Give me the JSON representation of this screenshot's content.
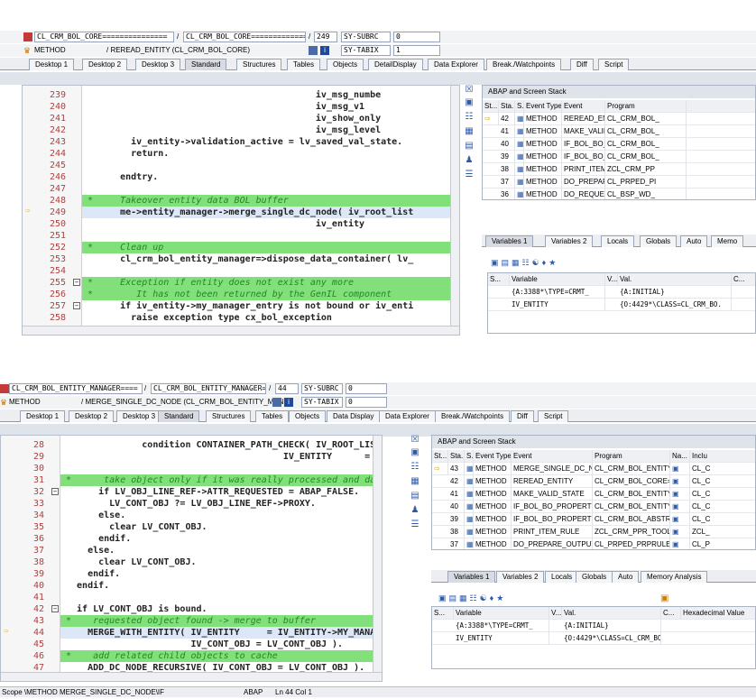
{
  "top": {
    "header1": {
      "class_a": "CL_CRM_BOL_CORE===============",
      "sep": "/",
      "class_b": "CL_CRM_BOL_CORE===============",
      "slash": "/",
      "line": "249",
      "sysvar": "SY-SUBRC",
      "sysval": "0"
    },
    "header2": {
      "type": "METHOD",
      "method": "/ REREAD_ENTITY (CL_CRM_BOL_CORE)",
      "sysvar": "SY-TABIX",
      "sysval": "1"
    },
    "tabs": [
      "Desktop 1",
      "Desktop 2",
      "Desktop 3",
      "Standard",
      "Structures",
      "Tables",
      "Objects",
      "DetailDisplay",
      "Data Explorer",
      "Break./Watchpoints",
      "Diff",
      "Script"
    ],
    "active_tab": 3,
    "code": [
      {
        "n": "239",
        "t": "                                          iv_msg_numbe",
        "style": "code"
      },
      {
        "n": "240",
        "t": "                                          iv_msg_v1",
        "style": "code"
      },
      {
        "n": "241",
        "t": "                                          iv_show_only",
        "style": "code"
      },
      {
        "n": "242",
        "t": "                                          iv_msg_level",
        "style": "code"
      },
      {
        "n": "243",
        "t": "        iv_entity->validation_active = lv_saved_val_state.",
        "style": "code"
      },
      {
        "n": "244",
        "t": "        return.",
        "style": "code"
      },
      {
        "n": "245",
        "t": "",
        "style": "code"
      },
      {
        "n": "246",
        "t": "      endtry.",
        "style": "code"
      },
      {
        "n": "247",
        "t": "",
        "style": "code"
      },
      {
        "n": "248",
        "t": "*     Takeover entity data BOL buffer",
        "style": "comment"
      },
      {
        "n": "249",
        "t": "      me->entity_manager->merge_single_dc_node( iv_root_list",
        "style": "code"
      },
      {
        "n": "250",
        "t": "                                          iv_entity",
        "style": "code"
      },
      {
        "n": "251",
        "t": "",
        "style": "code"
      },
      {
        "n": "252",
        "t": "*     Clean up",
        "style": "comment"
      },
      {
        "n": "253",
        "t": "      cl_crm_bol_entity_manager=>dispose_data_container( lv_",
        "style": "code"
      },
      {
        "n": "254",
        "t": "",
        "style": "code"
      },
      {
        "n": "255",
        "t": "*     Exception if entity does not exist any more",
        "style": "comment"
      },
      {
        "n": "256",
        "t": "*        It has not been returned by the GenIL component",
        "style": "comment"
      },
      {
        "n": "257",
        "t": "      if iv_entity->my_manager_entry is not bound or iv_enti",
        "style": "code"
      },
      {
        "n": "258",
        "t": "        raise exception type cx_bol_exception",
        "style": "code"
      }
    ],
    "stack": {
      "title": "ABAP and Screen Stack",
      "headers": [
        "St...",
        "Sta...",
        "S...",
        "Event Type",
        "Event",
        "Program"
      ],
      "rows": [
        {
          "sta": "42",
          "type": "METHOD",
          "event": "REREAD_ENTITY",
          "prog": "CL_CRM_BOL_"
        },
        {
          "sta": "41",
          "type": "METHOD",
          "event": "MAKE_VALID_STATE",
          "prog": "CL_CRM_BOL_"
        },
        {
          "sta": "40",
          "type": "METHOD",
          "event": "IF_BOL_BO_PROPERTY_...",
          "prog": "CL_CRM_BOL_"
        },
        {
          "sta": "39",
          "type": "METHOD",
          "event": "IF_BOL_BO_PROPERTY_...",
          "prog": "CL_CRM_BOL_"
        },
        {
          "sta": "38",
          "type": "METHOD",
          "event": "PRINT_ITEM_RULE",
          "prog": "ZCL_CRM_PP"
        },
        {
          "sta": "37",
          "type": "METHOD",
          "event": "DO_PREPARE_OUTPUT",
          "prog": "CL_PRPED_PI"
        },
        {
          "sta": "36",
          "type": "METHOD",
          "event": "DO_REQUEST",
          "prog": "CL_BSP_WD_"
        }
      ]
    },
    "var_tabs": [
      "Variables 1",
      "Variables 2",
      "Locals",
      "Globals",
      "Auto",
      "Memo"
    ],
    "vars": {
      "headers": [
        "S...",
        "Variable",
        "V...",
        "Val.",
        "C..."
      ],
      "rows": [
        {
          "name": "{A:3388*\\TYPE=CRMT_",
          "val": "{A:INITIAL}"
        },
        {
          "name": "IV_ENTITY",
          "val": "{O:4429*\\CLASS=CL_CRM_BO."
        }
      ]
    }
  },
  "bottom": {
    "header1": {
      "class_a": "CL_CRM_BOL_ENTITY_MANAGER====",
      "sep": "/",
      "class_b": "CL_CRM_BOL_ENTITY_MANAGER====",
      "slash": "/",
      "line": "44",
      "sysvar": "SY-SUBRC",
      "sysval": "0"
    },
    "header2": {
      "type": "METHOD",
      "method": "/ MERGE_SINGLE_DC_NODE (CL_CRM_BOL_ENTITY_MAN",
      "sysvar": "SY-TABIX",
      "sysval": "0"
    },
    "tabs": [
      "Desktop 1",
      "Desktop 2",
      "Desktop 3",
      "Standard",
      "Structures",
      "Tables",
      "Objects",
      "Data Display",
      "Data Explorer",
      "Break./Watchpoints",
      "Diff",
      "Script"
    ],
    "active_tab": 3,
    "code": [
      {
        "n": "28",
        "t": "              condition CONTAINER_PATH_CHECK( IV_ROOT_LIST =",
        "style": "code"
      },
      {
        "n": "29",
        "t": "                                        IV_ENTITY      =",
        "style": "code"
      },
      {
        "n": "30",
        "t": "",
        "style": "code"
      },
      {
        "n": "31",
        "t": "*      take object only if it was really processed and data s",
        "style": "comment"
      },
      {
        "n": "32",
        "t": "      if LV_OBJ_LINE_REF->ATTR_REQUESTED = ABAP_FALSE.",
        "style": "code"
      },
      {
        "n": "33",
        "t": "        LV_CONT_OBJ ?= LV_OBJ_LINE_REF->PROXY.",
        "style": "code"
      },
      {
        "n": "34",
        "t": "      else.",
        "style": "code"
      },
      {
        "n": "35",
        "t": "        clear LV_CONT_OBJ.",
        "style": "code"
      },
      {
        "n": "36",
        "t": "      endif.",
        "style": "code"
      },
      {
        "n": "37",
        "t": "    else.",
        "style": "code"
      },
      {
        "n": "38",
        "t": "      clear LV_CONT_OBJ.",
        "style": "code"
      },
      {
        "n": "39",
        "t": "    endif.",
        "style": "code"
      },
      {
        "n": "40",
        "t": "  endif.",
        "style": "code"
      },
      {
        "n": "41",
        "t": "",
        "style": "code"
      },
      {
        "n": "42",
        "t": "  if LV_CONT_OBJ is bound.",
        "style": "code"
      },
      {
        "n": "43",
        "t": "*    requested object found -> merge to buffer",
        "style": "comment"
      },
      {
        "n": "44",
        "t": "    MERGE_WITH_ENTITY( IV_ENTITY     = IV_ENTITY->MY_MANAGER_E",
        "style": "code"
      },
      {
        "n": "45",
        "t": "                       IV_CONT_OBJ = LV_CONT_OBJ ).",
        "style": "code"
      },
      {
        "n": "46",
        "t": "*    add related child objects to cache",
        "style": "comment"
      },
      {
        "n": "47",
        "t": "    ADD_DC_NODE_RECURSIVE( IV_CONT_OBJ = LV_CONT_OBJ )."
      }
    ],
    "stack": {
      "title": "ABAP and Screen Stack",
      "headers": [
        "St...",
        "Sta...",
        "S...",
        "Event Type",
        "Event",
        "Program",
        "Na...",
        "Inclu"
      ],
      "rows": [
        {
          "sta": "43",
          "type": "METHOD",
          "event": "MERGE_SINGLE_DC_NO...",
          "prog": "CL_CRM_BOL_ENTITY_M...",
          "incl": "CL_C"
        },
        {
          "sta": "42",
          "type": "METHOD",
          "event": "REREAD_ENTITY",
          "prog": "CL_CRM_BOL_CORE====...",
          "incl": "CL_C"
        },
        {
          "sta": "41",
          "type": "METHOD",
          "event": "MAKE_VALID_STATE",
          "prog": "CL_CRM_BOL_ENTITY=...",
          "incl": "CL_C"
        },
        {
          "sta": "40",
          "type": "METHOD",
          "event": "IF_BOL_BO_PROPERTY_...",
          "prog": "CL_CRM_BOL_ENTITY=...",
          "incl": "CL_C"
        },
        {
          "sta": "39",
          "type": "METHOD",
          "event": "IF_BOL_BO_PROPERTY_...",
          "prog": "CL_CRM_BOL_ABSTR_B...",
          "incl": "CL_C"
        },
        {
          "sta": "38",
          "type": "METHOD",
          "event": "PRINT_ITEM_RULE",
          "prog": "ZCL_CRM_PPR_TOOL==...",
          "incl": "ZCL_"
        },
        {
          "sta": "37",
          "type": "METHOD",
          "event": "DO_PREPARE_OUTPUT",
          "prog": "CL_PRPED_PRPRULEPAR...",
          "incl": "CL_P"
        }
      ]
    },
    "var_tabs": [
      "Variables 1",
      "Variables 2",
      "Locals",
      "Globals",
      "Auto",
      "Memory Analysis"
    ],
    "vars": {
      "headers": [
        "S...",
        "Variable",
        "V...",
        "Val.",
        "C...",
        "Hexadecimal Value"
      ],
      "rows": [
        {
          "name": "{A:3388*\\TYPE=CRMT_",
          "val": "{A:INITIAL}"
        },
        {
          "name": "IV_ENTITY",
          "val": "{O:4429*\\CLASS=CL_CRM_BO."
        }
      ]
    },
    "status": {
      "scope": "Scope \\METHOD MERGE_SINGLE_DC_NODE\\IF",
      "lang": "ABAP",
      "pos": "Ln  44 Col  1"
    }
  },
  "colors": {
    "comment_highlight": "#82e07a",
    "keyword": "#1f3a93",
    "comment": "#228822",
    "line_number": "#b04040",
    "current_line_arrow": "#e0a000"
  },
  "icons": [
    "method-icon",
    "info-icon",
    "debug-arrow-icon",
    "toolbar-icon"
  ]
}
